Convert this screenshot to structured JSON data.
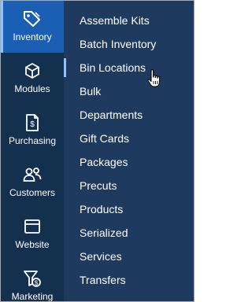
{
  "sidebar": {
    "items": [
      {
        "label": "Inventory",
        "icon": "tag-gear-icon",
        "active": true
      },
      {
        "label": "Modules",
        "icon": "cube-icon"
      },
      {
        "label": "Purchasing",
        "icon": "dollar-document-icon"
      },
      {
        "label": "Customers",
        "icon": "users-icon"
      },
      {
        "label": "Website",
        "icon": "browser-window-icon"
      },
      {
        "label": "Marketing",
        "icon": "funnel-dollar-icon"
      }
    ]
  },
  "submenu": {
    "items": [
      {
        "label": "Assemble Kits"
      },
      {
        "label": "Batch Inventory"
      },
      {
        "label": "Bin Locations",
        "hovered": true
      },
      {
        "label": "Bulk"
      },
      {
        "label": "Departments"
      },
      {
        "label": "Gift Cards"
      },
      {
        "label": "Packages"
      },
      {
        "label": "Precuts"
      },
      {
        "label": "Products"
      },
      {
        "label": "Serialized"
      },
      {
        "label": "Services"
      },
      {
        "label": "Transfers"
      }
    ]
  },
  "colors": {
    "sidebar_bg": "#14304f",
    "submenu_bg": "#1f3a5f",
    "active_bg": "#1a5fb4",
    "accent": "#8fc3ff",
    "text": "#ffffff"
  }
}
